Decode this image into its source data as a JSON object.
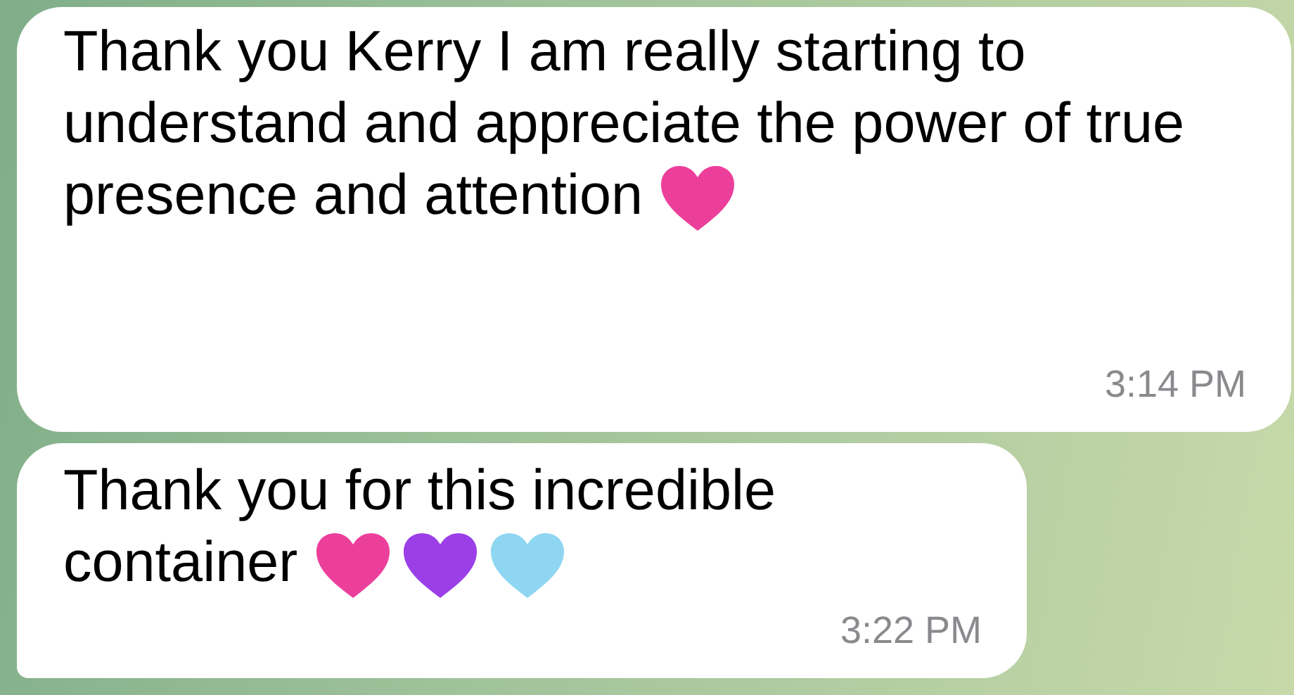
{
  "messages": [
    {
      "text": "Thank you Kerry I am really starting to understand and appreciate the power of true presence and attention",
      "hearts": [
        {
          "color": "#ec3f9c"
        }
      ],
      "time": "3:14 PM"
    },
    {
      "text": "Thank you for this incredible container",
      "hearts": [
        {
          "color": "#ec3f9c"
        },
        {
          "color": "#9b3fe8"
        },
        {
          "color": "#8fd6f2"
        }
      ],
      "time": "3:22 PM"
    }
  ]
}
